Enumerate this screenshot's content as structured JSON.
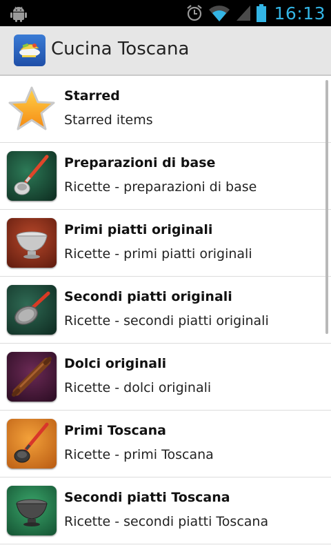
{
  "status_bar": {
    "time": "16:13",
    "icons": [
      "android-icon",
      "alarm-icon",
      "wifi-icon",
      "signal-icon",
      "battery-icon"
    ]
  },
  "action_bar": {
    "title": "Cucina Toscana"
  },
  "list": {
    "items": [
      {
        "title": "Starred",
        "subtitle": "Starred items",
        "icon": "star-icon"
      },
      {
        "title": "Preparazioni di base",
        "subtitle": "Ricette - preparazioni di base",
        "icon": "ladle-icon"
      },
      {
        "title": "Primi piatti originali",
        "subtitle": "Ricette - primi piatti originali",
        "icon": "colander-icon"
      },
      {
        "title": "Secondi piatti originali",
        "subtitle": "Ricette - secondi piatti originali",
        "icon": "pan-icon"
      },
      {
        "title": "Dolci originali",
        "subtitle": "Ricette - dolci originali",
        "icon": "rolling-pin-icon"
      },
      {
        "title": "Primi Toscana",
        "subtitle": "Ricette - primi Toscana",
        "icon": "ladle-icon"
      },
      {
        "title": "Secondi piatti Toscana",
        "subtitle": "Ricette - secondi piatti Toscana",
        "icon": "colander-icon"
      }
    ]
  },
  "colors": {
    "statusbar_bg": "#000000",
    "clock": "#33b5e5",
    "actionbar_bg": "#e6e6e6",
    "divider": "#dcdcdc"
  }
}
